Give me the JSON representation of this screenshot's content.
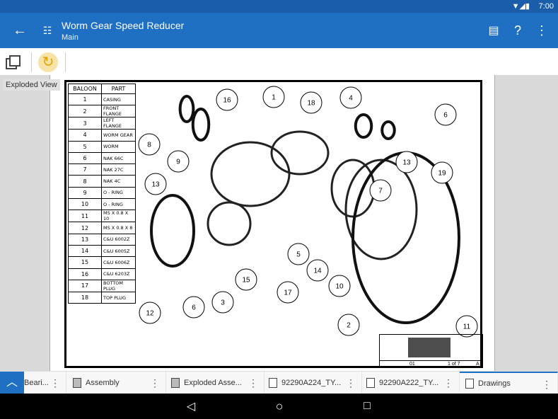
{
  "status": {
    "time": "7:00"
  },
  "appbar": {
    "title": "Worm Gear Speed Reducer",
    "subtitle": "Main"
  },
  "toolbar": {
    "tooltip": "Exploded View"
  },
  "bom": {
    "headers": [
      "BALOON",
      "PART"
    ],
    "rows": [
      [
        "1",
        "CASING"
      ],
      [
        "2",
        "FRONT FLANGE"
      ],
      [
        "3",
        "LEFT FLANGE"
      ],
      [
        "4",
        "WORM GEAR"
      ],
      [
        "5",
        "WORM"
      ],
      [
        "6",
        "NAK 66C"
      ],
      [
        "7",
        "NAK 27C"
      ],
      [
        "8",
        "NAK 4C"
      ],
      [
        "9",
        "O - RING"
      ],
      [
        "10",
        "O - RING"
      ],
      [
        "11",
        "MS X 0.8 X 10"
      ],
      [
        "12",
        "MS X 0.8 X 8"
      ],
      [
        "13",
        "C&U 6002Z"
      ],
      [
        "14",
        "C&U 6005Z"
      ],
      [
        "15",
        "C&U 6006Z"
      ],
      [
        "16",
        "C&U 6203Z"
      ],
      [
        "17",
        "BOTTOM PLUG"
      ],
      [
        "18",
        "TOP PLUG"
      ]
    ]
  },
  "balloons": [
    "16",
    "1",
    "18",
    "4",
    "6",
    "8",
    "9",
    "13",
    "19",
    "13",
    "7",
    "5",
    "14",
    "15",
    "10",
    "17",
    "3",
    "6",
    "12",
    "2",
    "11"
  ],
  "title_block": {
    "sheet_no": "01",
    "sheet": "1 of 7",
    "rev": "A"
  },
  "tabs": [
    {
      "label": "Beari...",
      "icon": "part-icon"
    },
    {
      "label": "Assembly",
      "icon": "assembly-icon"
    },
    {
      "label": "Exploded Asse...",
      "icon": "assembly-icon"
    },
    {
      "label": "92290A224_TY...",
      "icon": "part-icon"
    },
    {
      "label": "92290A222_TY...",
      "icon": "part-icon"
    },
    {
      "label": "Drawings",
      "icon": "drawing-icon",
      "active": true
    }
  ],
  "colors": {
    "appbar": "#1f6fc2",
    "status": "#1a5ea9",
    "accent": "#1f6fc2"
  }
}
